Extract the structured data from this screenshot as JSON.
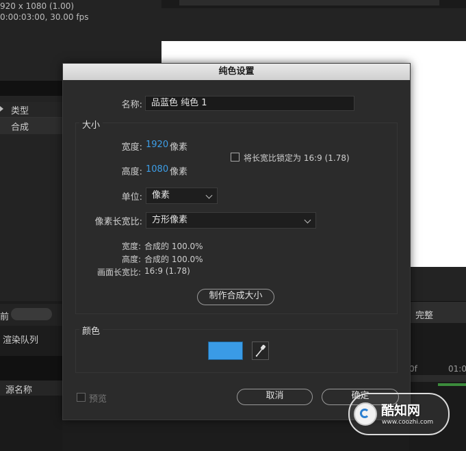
{
  "background": {
    "composition_info": {
      "resolution": "920 x 1080 (1.00)",
      "duration": "0:00:03:00, 30.00 fps"
    },
    "columns": {
      "type": "类型"
    },
    "rows": {
      "composition": "合成"
    },
    "left_tab": "前",
    "render_queue": "渲染队列",
    "source_name": "源名称",
    "quality_label": "完整",
    "timeline_ticks": [
      "0f",
      "01:0"
    ]
  },
  "dialog": {
    "title": "纯色设置",
    "name_label": "名称:",
    "name_value": "品蓝色 纯色 1",
    "size_group": {
      "title": "大小",
      "width_label": "宽度:",
      "width_value": "1920",
      "width_unit": "像素",
      "height_label": "高度:",
      "height_value": "1080",
      "height_unit": "像素",
      "lock_ratio_label": "将长宽比锁定为 16:9 (1.78)",
      "lock_ratio_checked": false,
      "units_label": "单位:",
      "units_value": "像素",
      "pixel_aspect_label": "像素长宽比:",
      "pixel_aspect_value": "方形像素",
      "info_width_label": "宽度:",
      "info_width_value": "合成的 100.0%",
      "info_height_label": "高度:",
      "info_height_value": "合成的 100.0%",
      "info_frame_aspect_label": "画面长宽比:",
      "info_frame_aspect_value": "16:9 (1.78)",
      "make_comp_size_button": "制作合成大小"
    },
    "color_group": {
      "title": "颜色",
      "swatch_color": "#3a9be6"
    },
    "preview_label": "预览",
    "cancel_button": "取消",
    "ok_button": "确定"
  },
  "watermark": {
    "brand": "酷知网",
    "url": "www.coozhi.com"
  },
  "colors": {
    "accent_blue": "#3d9fe8",
    "dialog_bg": "#2b2b2b",
    "title_bar": "#dcdcdc"
  }
}
